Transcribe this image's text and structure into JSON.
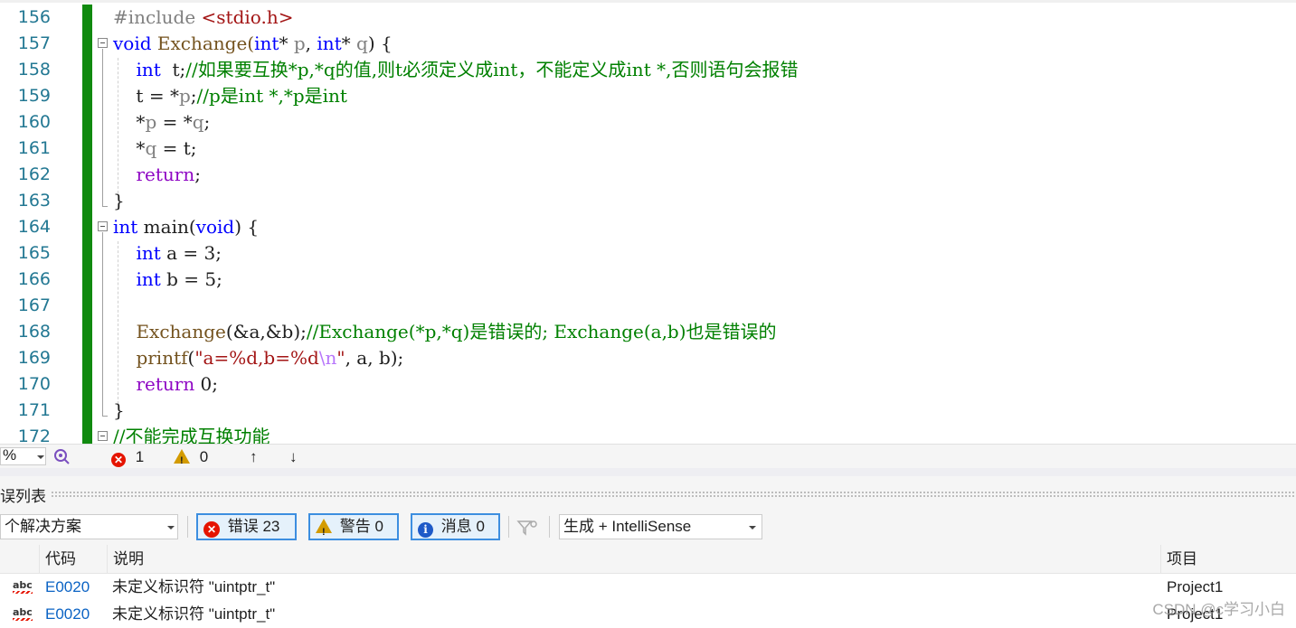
{
  "editor": {
    "lines": [
      {
        "num": "156",
        "segs": [
          {
            "t": "#include ",
            "c": "pp"
          },
          {
            "t": "<stdio.h>",
            "c": "str"
          }
        ]
      },
      {
        "num": "157",
        "segs": [
          {
            "t": "void",
            "c": "kw"
          },
          {
            "t": " Exchange(",
            "c": "fn"
          },
          {
            "t": "int",
            "c": "kw"
          },
          {
            "t": "* ",
            "c": ""
          },
          {
            "t": "p",
            "c": "par"
          },
          {
            "t": ", ",
            "c": ""
          },
          {
            "t": "int",
            "c": "kw"
          },
          {
            "t": "* ",
            "c": ""
          },
          {
            "t": "q",
            "c": "par"
          },
          {
            "t": ") {",
            "c": ""
          }
        ]
      },
      {
        "num": "158",
        "segs": [
          {
            "t": "    ",
            "c": ""
          },
          {
            "t": "int",
            "c": "kw"
          },
          {
            "t": "  t;",
            "c": ""
          },
          {
            "t": "//如果要互换*p,*q的值,则t必须定义成int，不能定义成int *,否则语句会报错",
            "c": "cm"
          }
        ]
      },
      {
        "num": "159",
        "segs": [
          {
            "t": "    t = *",
            "c": ""
          },
          {
            "t": "p",
            "c": "par"
          },
          {
            "t": ";",
            "c": ""
          },
          {
            "t": "//p是int *,*p是int",
            "c": "cm"
          }
        ]
      },
      {
        "num": "160",
        "segs": [
          {
            "t": "    *",
            "c": ""
          },
          {
            "t": "p",
            "c": "par"
          },
          {
            "t": " = *",
            "c": ""
          },
          {
            "t": "q",
            "c": "par"
          },
          {
            "t": ";",
            "c": ""
          }
        ]
      },
      {
        "num": "161",
        "segs": [
          {
            "t": "    *",
            "c": ""
          },
          {
            "t": "q",
            "c": "par"
          },
          {
            "t": " = t;",
            "c": ""
          }
        ]
      },
      {
        "num": "162",
        "segs": [
          {
            "t": "    ",
            "c": ""
          },
          {
            "t": "return",
            "c": "ctl"
          },
          {
            "t": ";",
            "c": ""
          }
        ]
      },
      {
        "num": "163",
        "segs": [
          {
            "t": "}",
            "c": ""
          }
        ]
      },
      {
        "num": "164",
        "segs": [
          {
            "t": "int",
            "c": "kw"
          },
          {
            "t": " main(",
            "c": ""
          },
          {
            "t": "void",
            "c": "kw"
          },
          {
            "t": ") {",
            "c": ""
          }
        ]
      },
      {
        "num": "165",
        "segs": [
          {
            "t": "    ",
            "c": ""
          },
          {
            "t": "int",
            "c": "kw"
          },
          {
            "t": " a = 3;",
            "c": ""
          }
        ]
      },
      {
        "num": "166",
        "segs": [
          {
            "t": "    ",
            "c": ""
          },
          {
            "t": "int",
            "c": "kw"
          },
          {
            "t": " b = 5;",
            "c": ""
          }
        ]
      },
      {
        "num": "167",
        "segs": [
          {
            "t": "",
            "c": ""
          }
        ]
      },
      {
        "num": "168",
        "segs": [
          {
            "t": "    ",
            "c": ""
          },
          {
            "t": "Exchange",
            "c": "fn"
          },
          {
            "t": "(&a,&b);",
            "c": ""
          },
          {
            "t": "//Exchange(*p,*q)是错误的; Exchange(a,b)也是错误的",
            "c": "cm"
          }
        ]
      },
      {
        "num": "169",
        "segs": [
          {
            "t": "    ",
            "c": ""
          },
          {
            "t": "printf",
            "c": "fn"
          },
          {
            "t": "(",
            "c": ""
          },
          {
            "t": "\"a=%d,b=%d",
            "c": "str"
          },
          {
            "t": "\\n",
            "c": "esc"
          },
          {
            "t": "\"",
            "c": "str"
          },
          {
            "t": ", a, b);",
            "c": ""
          }
        ]
      },
      {
        "num": "170",
        "segs": [
          {
            "t": "    ",
            "c": ""
          },
          {
            "t": "return",
            "c": "ctl"
          },
          {
            "t": " 0;",
            "c": ""
          }
        ]
      },
      {
        "num": "171",
        "segs": [
          {
            "t": "}",
            "c": ""
          }
        ]
      },
      {
        "num": "172",
        "segs": [
          {
            "t": "//不能完成互换功能",
            "c": "cm"
          }
        ]
      }
    ]
  },
  "status": {
    "zoom": "%",
    "errors": "1",
    "warnings": "0",
    "up_arrow": "↑",
    "down_arrow": "↓"
  },
  "error_list": {
    "title": "误列表",
    "scope": "个解决方案",
    "errors_btn": "错误 23",
    "warnings_btn": "警告 0",
    "messages_btn": "消息 0",
    "build_filter": "生成 + IntelliSense",
    "columns": {
      "code": "代码",
      "description": "说明",
      "project": "项目"
    },
    "rows": [
      {
        "code": "E0020",
        "description": "未定义标识符 \"uintptr_t\"",
        "project": "Project1",
        "icon": "abc"
      },
      {
        "code": "E0020",
        "description": "未定义标识符 \"uintptr_t\"",
        "project": "Project1",
        "icon": "abc"
      }
    ]
  },
  "watermark": "CSDN @c学习小白"
}
